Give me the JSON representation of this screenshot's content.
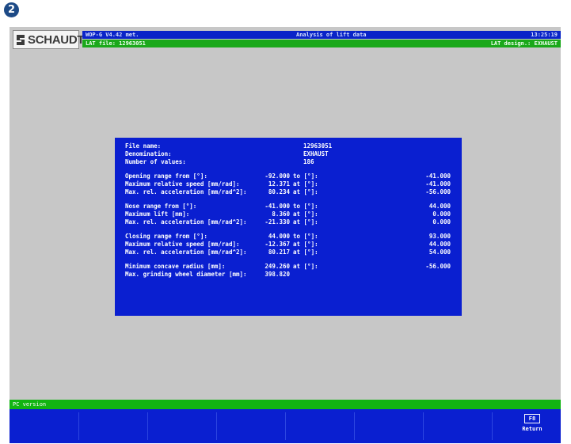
{
  "step_number": "2",
  "logo": {
    "text": "SCHAUDT"
  },
  "header": {
    "program": "WOP-G V4.42 met.",
    "title": "Analysis of lift data",
    "time": "13:25:19",
    "file_label": "LAT file: 12963051",
    "designation": "LAT design.: EXHAUST"
  },
  "panel": {
    "file_name": {
      "label": "File name:",
      "value": "12963051"
    },
    "denomination": {
      "label": "Denomination:",
      "value": "EXHAUST"
    },
    "num_values": {
      "label": "Number of values:",
      "value": "186"
    },
    "opening": [
      {
        "label": "Opening range from [°]:",
        "v1": "-92.000",
        "mid": "to [°]:",
        "v2": "-41.000"
      },
      {
        "label": "Maximum relative speed [mm/rad]:",
        "v1": "12.371",
        "mid": "at [°]:",
        "v2": "-41.000"
      },
      {
        "label": "Max. rel. acceleration [mm/rad^2]:",
        "v1": "80.234",
        "mid": "at [°]:",
        "v2": "-56.000"
      }
    ],
    "nose": [
      {
        "label": "Nose range from [°]:",
        "v1": "-41.000",
        "mid": "to [°]:",
        "v2": "44.000"
      },
      {
        "label": "Maximum lift [mm]:",
        "v1": "8.360",
        "mid": "at [°]:",
        "v2": "0.000"
      },
      {
        "label": "Max. rel. acceleration [mm/rad^2]:",
        "v1": "-21.330",
        "mid": "at [°]:",
        "v2": "0.000"
      }
    ],
    "closing": [
      {
        "label": "Closing range from [°]:",
        "v1": "44.000",
        "mid": "to [°]:",
        "v2": "93.000"
      },
      {
        "label": "Maximum relative speed [mm/rad]:",
        "v1": "-12.367",
        "mid": "at [°]:",
        "v2": "44.000"
      },
      {
        "label": "Max. rel. acceleration [mm/rad^2]:",
        "v1": "80.217",
        "mid": "at [°]:",
        "v2": "54.000"
      }
    ],
    "min_concave": {
      "label": "Minimum concave radius [mm]:",
      "v1": "249.260",
      "mid": "at [°]:",
      "v2": "-56.000"
    },
    "max_wheel": {
      "label": "Max. grinding wheel diameter [mm]:",
      "v1": "398.820"
    }
  },
  "status_bar": {
    "text": "PC version"
  },
  "fkeys": {
    "f8": {
      "key": "F8",
      "label": "Return"
    }
  },
  "colors": {
    "header_blue": "#0a24c8",
    "header_green": "#1aa81a",
    "panel_blue": "#0a1fd0",
    "screen_gray": "#c7c7c7"
  }
}
